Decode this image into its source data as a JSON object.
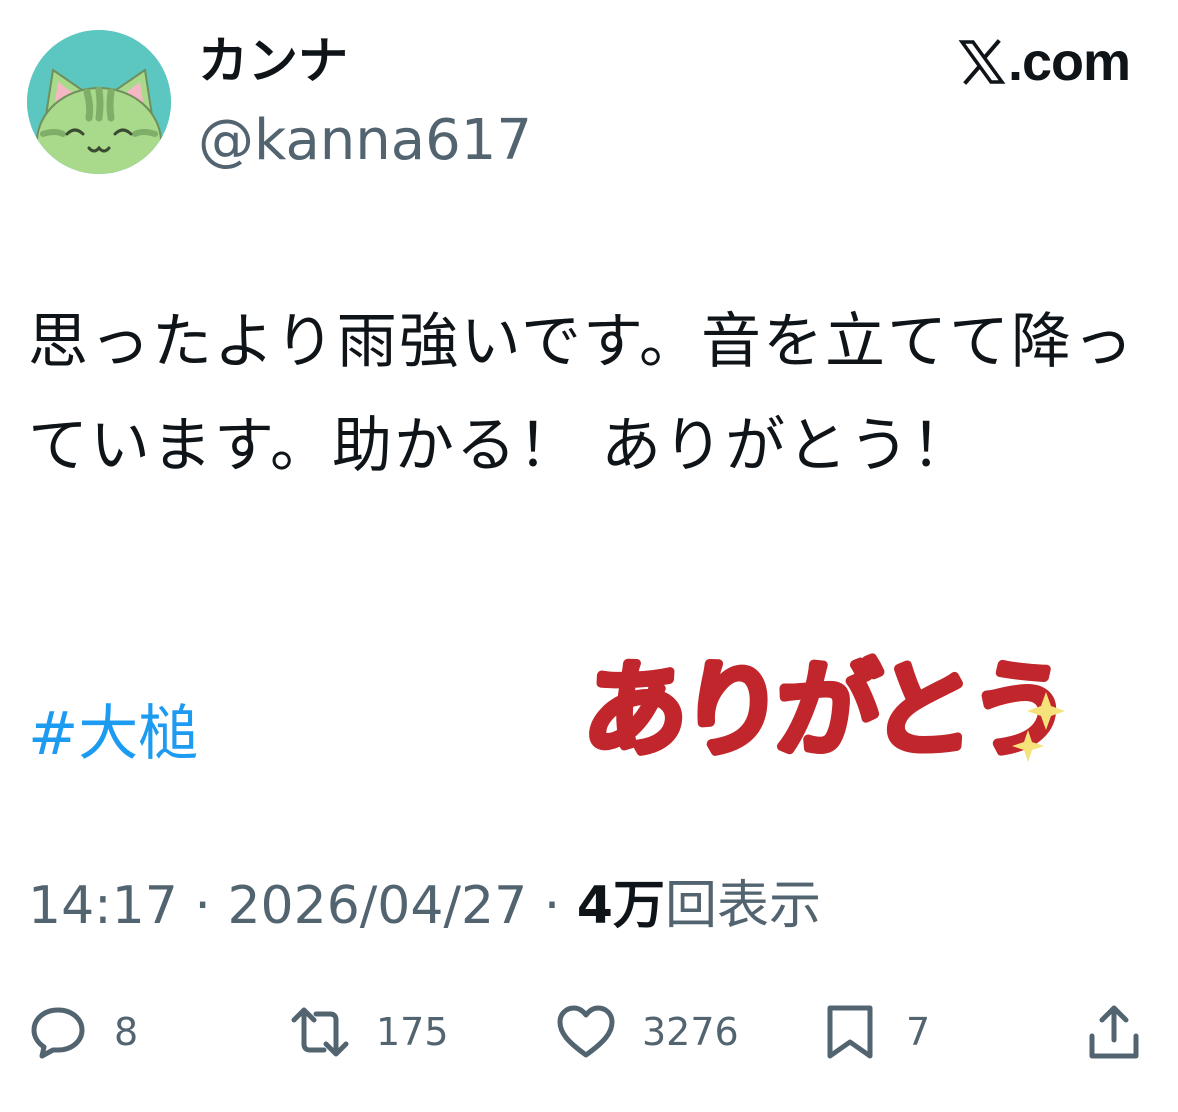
{
  "author": {
    "display_name": "カンナ",
    "handle": "@kanna617"
  },
  "site": {
    "label": ".com",
    "logo_icon": "x-logo-icon"
  },
  "tweet": {
    "text": "思ったより雨強いです。音を立てて降っています。助かる！ ありがとう！",
    "hashtag": "#大槌",
    "sticker_text": "ありがとう"
  },
  "meta": {
    "time": "14:17",
    "separator": "·",
    "date": "2026/04/27",
    "views_count": "4万",
    "views_label": "回表示"
  },
  "actions": {
    "reply": {
      "icon": "reply-icon",
      "count": "8"
    },
    "repost": {
      "icon": "repost-icon",
      "count": "175"
    },
    "like": {
      "icon": "heart-icon",
      "count": "3276"
    },
    "bookmark": {
      "icon": "bookmark-icon",
      "count": "7"
    },
    "share": {
      "icon": "share-icon"
    }
  },
  "colors": {
    "text": "#0f1419",
    "secondary": "#536471",
    "link": "#1d9bf0",
    "avatar_bg": "#5cc7c0",
    "sticker_red": "#c0262b",
    "sparkle": "#f5e27a"
  }
}
